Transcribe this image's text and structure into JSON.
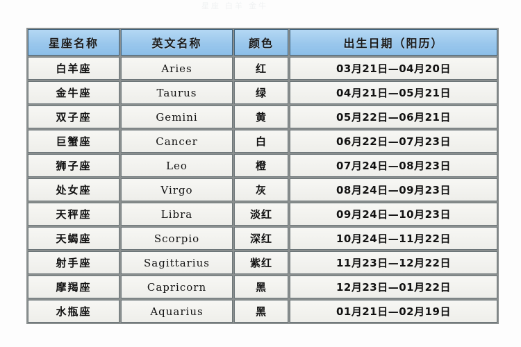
{
  "page": {
    "top_fragment": "星座  白羊  金牛"
  },
  "table": {
    "columns": [
      {
        "key": "name",
        "label": "星座名称"
      },
      {
        "key": "en",
        "label": "英文名称"
      },
      {
        "key": "color",
        "label": "颜色"
      },
      {
        "key": "date",
        "label": "出生日期（阳历）"
      }
    ],
    "rows": [
      {
        "name": "白羊座",
        "en": "Aries",
        "color": "红",
        "date": "03月21日—04月20日"
      },
      {
        "name": "金牛座",
        "en": "Taurus",
        "color": "绿",
        "date": "04月21日—05月21日"
      },
      {
        "name": "双子座",
        "en": "Gemini",
        "color": "黄",
        "date": "05月22日—06月21日"
      },
      {
        "name": "巨蟹座",
        "en": "Cancer",
        "color": "白",
        "date": "06月22日—07月23日"
      },
      {
        "name": "狮子座",
        "en": "Leo",
        "color": "橙",
        "date": "07月24日—08月23日"
      },
      {
        "name": "处女座",
        "en": "Virgo",
        "color": "灰",
        "date": "08月24日—09月23日"
      },
      {
        "name": "天秤座",
        "en": "Libra",
        "color": "淡红",
        "date": "09月24日—10月23日"
      },
      {
        "name": "天蝎座",
        "en": "Scorpio",
        "color": "深红",
        "date": "10月24日—11月22日"
      },
      {
        "name": "射手座",
        "en": "Sagittarius",
        "color": "紫红",
        "date": "11月23日—12月22日"
      },
      {
        "name": "摩羯座",
        "en": "Capricorn",
        "color": "黑",
        "date": "12月23日—01月22日"
      },
      {
        "name": "水瓶座",
        "en": "Aquarius",
        "color": "黑",
        "date": "01月21日—02月19日"
      }
    ]
  },
  "theme": {
    "header_bg": "#9fcbee",
    "header_border": "#41637c",
    "cell_bg": "#f2f2ee",
    "cell_border": "#6c7578",
    "page_bg": "#fdfdfd",
    "text": "#121212"
  }
}
